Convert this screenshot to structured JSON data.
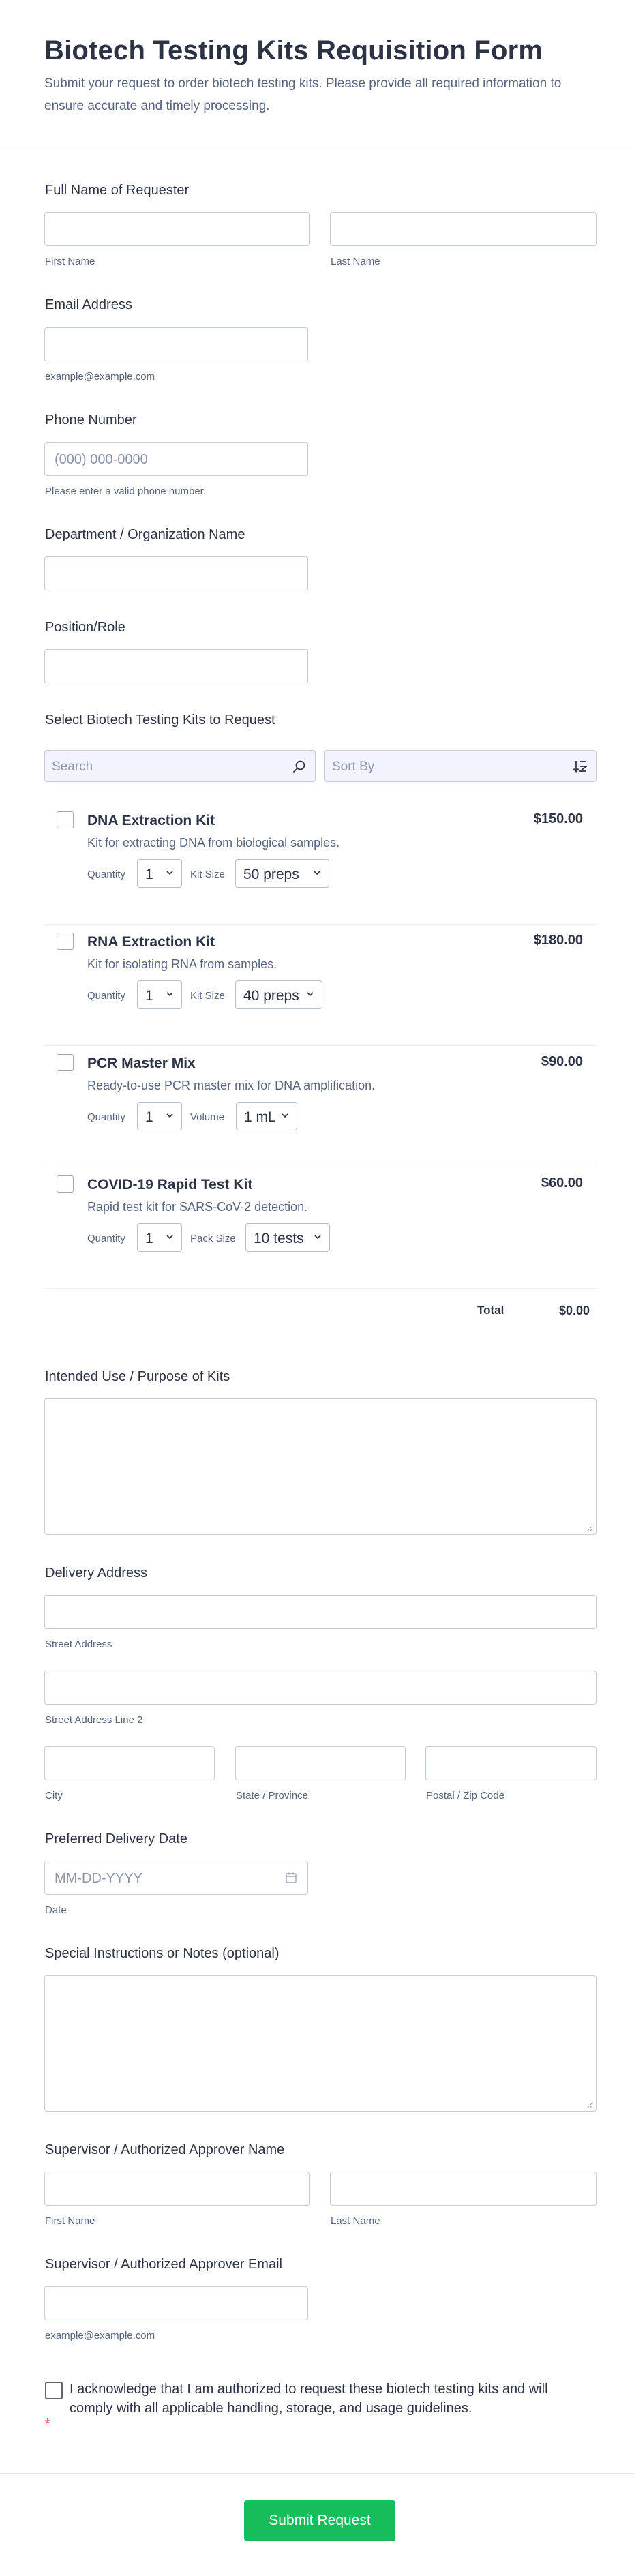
{
  "header": {
    "title": "Biotech Testing Kits Requisition Form",
    "description": "Submit your request to order biotech testing kits. Please provide all required information to ensure accurate and timely processing."
  },
  "requester": {
    "label": "Full Name of Requester",
    "first_sublabel": "First Name",
    "last_sublabel": "Last Name"
  },
  "email": {
    "label": "Email Address",
    "sublabel": "example@example.com"
  },
  "phone": {
    "label": "Phone Number",
    "placeholder": "(000) 000-0000",
    "sublabel": "Please enter a valid phone number."
  },
  "department": {
    "label": "Department / Organization Name"
  },
  "position": {
    "label": "Position/Role"
  },
  "kits": {
    "label": "Select Biotech Testing Kits to Request",
    "search_placeholder": "Search",
    "sort_placeholder": "Sort By",
    "quantity_label": "Quantity",
    "items": [
      {
        "name": "DNA Extraction Kit",
        "description": "Kit for extracting DNA from biological samples.",
        "price": "$150.00",
        "quantity": "1",
        "option_label": "Kit Size",
        "option_value": "50 preps"
      },
      {
        "name": "RNA Extraction Kit",
        "description": "Kit for isolating RNA from samples.",
        "price": "$180.00",
        "quantity": "1",
        "option_label": "Kit Size",
        "option_value": "40 preps"
      },
      {
        "name": "PCR Master Mix",
        "description": "Ready-to-use PCR master mix for DNA amplification.",
        "price": "$90.00",
        "quantity": "1",
        "option_label": "Volume",
        "option_value": "1 mL"
      },
      {
        "name": "COVID-19 Rapid Test Kit",
        "description": "Rapid test kit for SARS-CoV-2 detection.",
        "price": "$60.00",
        "quantity": "1",
        "option_label": "Pack Size",
        "option_value": "10 tests"
      }
    ],
    "total_label": "Total",
    "total_value": "$0.00"
  },
  "purpose": {
    "label": "Intended Use / Purpose of Kits"
  },
  "address": {
    "label": "Delivery Address",
    "street": "Street Address",
    "street2": "Street Address Line 2",
    "city": "City",
    "state": "State / Province",
    "zip": "Postal / Zip Code"
  },
  "delivery_date": {
    "label": "Preferred Delivery Date",
    "placeholder": "MM-DD-YYYY",
    "sublabel": "Date"
  },
  "notes": {
    "label": "Special Instructions or Notes (optional)"
  },
  "supervisor": {
    "label": "Supervisor / Authorized Approver Name",
    "first_sublabel": "First Name",
    "last_sublabel": "Last Name"
  },
  "supervisor_email": {
    "label": "Supervisor / Authorized Approver Email",
    "sublabel": "example@example.com"
  },
  "acknowledgement": {
    "text": "I acknowledge that I am authorized to request these biotech testing kits and will comply with all applicable handling, storage, and usage guidelines.",
    "required_mark": "*"
  },
  "submit": {
    "label": "Submit Request"
  },
  "colors": {
    "accent": "#18bd5b",
    "text": "#2c3345",
    "muted": "#57647e",
    "border": "#c3cad8",
    "required": "#f23a3c"
  }
}
